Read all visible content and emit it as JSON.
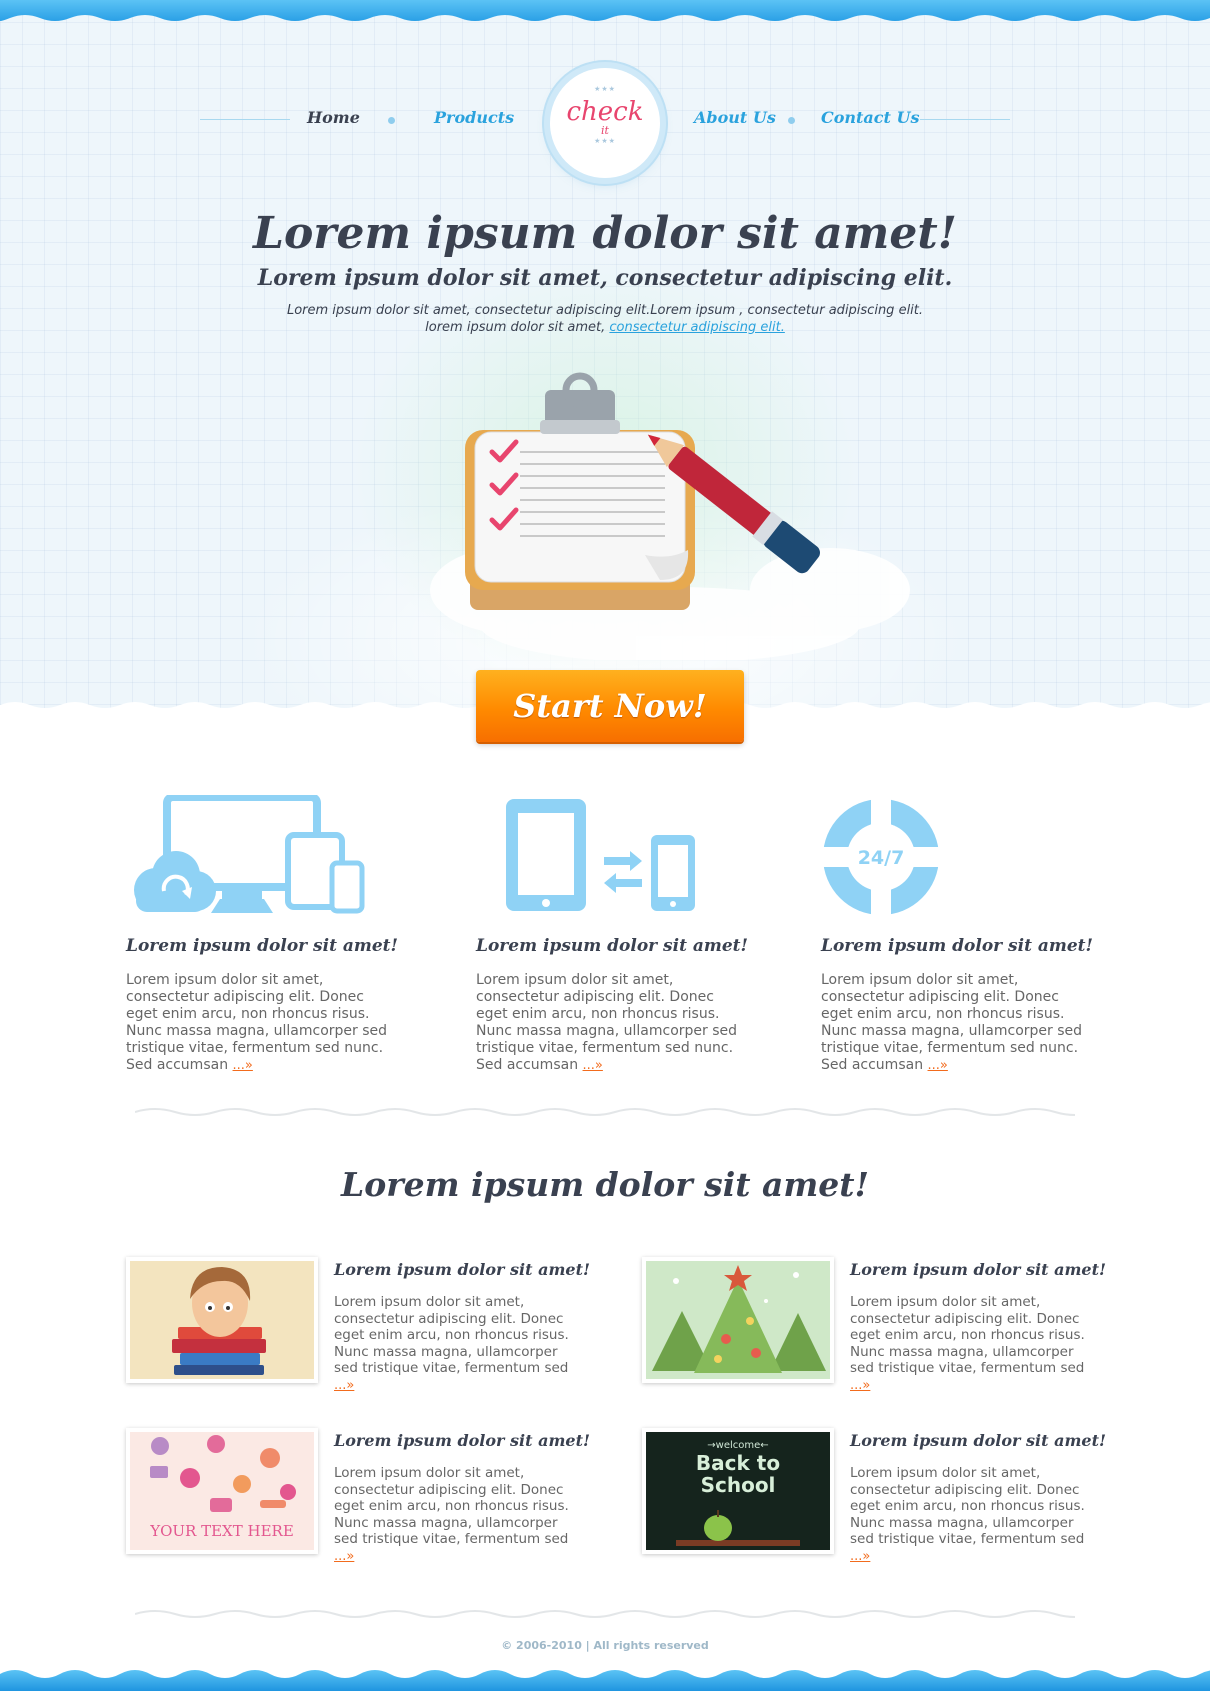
{
  "nav": {
    "items": [
      {
        "label": "Home",
        "active": true
      },
      {
        "label": "Products"
      },
      {
        "label": "About Us"
      },
      {
        "label": "Contact Us"
      }
    ]
  },
  "logo": {
    "stars": "★★★",
    "word": "check",
    "sub": "it"
  },
  "hero": {
    "title": "Lorem ipsum dolor sit amet!",
    "subtitle": "Lorem ipsum dolor sit amet, consectetur adipiscing elit.",
    "text_line1": "Lorem ipsum dolor sit amet, consectetur adipiscing elit.Lorem ipsum , consectetur adipiscing elit.",
    "text_line2": "lorem ipsum dolor sit amet,",
    "text_link": "consectetur adipiscing elit.",
    "cta_label": "Start Now!"
  },
  "features": [
    {
      "icon": "devices-sync-icon",
      "title": "Lorem ipsum dolor sit amet!",
      "body": "Lorem ipsum dolor sit amet, consectetur adipiscing elit. Donec eget enim arcu, non rhoncus risus. Nunc massa magna, ullamcorper sed tristique vitae, fermentum sed nunc. Sed accumsan",
      "more": "...»"
    },
    {
      "icon": "tablet-phone-sync-icon",
      "title": "Lorem ipsum dolor sit amet!",
      "body": "Lorem ipsum dolor sit amet, consectetur adipiscing elit. Donec eget enim arcu, non rhoncus risus. Nunc massa magna, ullamcorper sed tristique vitae, fermentum sed nunc. Sed accumsan",
      "more": "...»"
    },
    {
      "icon": "lifebuoy-24-7-icon",
      "icon_text": "24/7",
      "title": "Lorem ipsum dolor sit amet!",
      "body": "Lorem ipsum dolor sit amet, consectetur adipiscing elit. Donec eget enim arcu, non rhoncus risus. Nunc massa magna, ullamcorper sed tristique vitae, fermentum sed nunc. Sed accumsan",
      "more": "...»"
    }
  ],
  "section_title": "Lorem ipsum dolor sit amet!",
  "posts": [
    {
      "thumb": "boy-with-books-image",
      "title": "Lorem ipsum dolor sit amet!",
      "body": "Lorem ipsum dolor sit amet, consectetur adipiscing elit. Donec eget enim arcu, non rhoncus risus. Nunc massa magna, ullamcorper sed tristique vitae, fermentum sed",
      "more": "...»"
    },
    {
      "thumb": "christmas-trees-image",
      "title": "Lorem ipsum dolor sit amet!",
      "body": "Lorem ipsum dolor sit amet, consectetur adipiscing elit. Donec eget enim arcu, non rhoncus risus. Nunc massa magna, ullamcorper sed tristique vitae, fermentum sed",
      "more": "...»"
    },
    {
      "thumb": "tools-pattern-image",
      "thumb_text": "YOUR TEXT HERE",
      "title": "Lorem ipsum dolor sit amet!",
      "body": "Lorem ipsum dolor sit amet, consectetur adipiscing elit. Donec eget enim arcu, non rhoncus risus. Nunc massa magna, ullamcorper sed tristique vitae, fermentum sed",
      "more": "...»"
    },
    {
      "thumb": "back-to-school-image",
      "thumb_text_small": "→welcome←",
      "thumb_text_line1": "Back to",
      "thumb_text_line2": "School",
      "title": "Lorem ipsum dolor sit amet!",
      "body": "Lorem ipsum dolor sit amet, consectetur adipiscing elit. Donec eget enim arcu, non rhoncus risus. Nunc massa magna, ullamcorper sed tristique vitae, fermentum sed",
      "more": "...»"
    }
  ],
  "footer": {
    "copyright": "© 2006-2010 | All rights reserved"
  },
  "colors": {
    "accent_blue": "#2aa2dd",
    "icon_blue": "#8fd2f5",
    "cta_orange": "#ff8a00",
    "dark_text": "#3a4150",
    "link_orange": "#f26b1d",
    "logo_pink": "#e8456e"
  }
}
